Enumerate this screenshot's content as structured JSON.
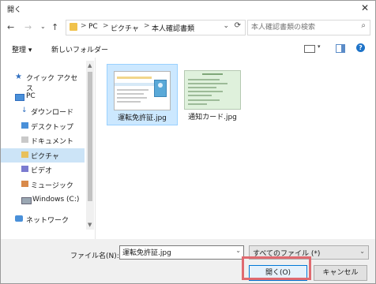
{
  "window": {
    "title": "開く",
    "close_glyph": "✕"
  },
  "nav": {
    "back_glyph": "←",
    "forward_glyph": "→",
    "history_glyph": "⌄",
    "up_glyph": "↑",
    "breadcrumb": [
      "PC",
      "ピクチャ",
      "本人確認書類"
    ],
    "crumb_separator": ">",
    "dropdown_glyph": "⌄",
    "refresh_glyph": "⟳",
    "search_placeholder": "本人確認書類の検索",
    "search_glyph": "⌕"
  },
  "toolbar": {
    "organize": "整理 ▾",
    "new_folder": "新しいフォルダー",
    "view_dropdown_glyph": "▾",
    "help": "?"
  },
  "sidebar": {
    "items": [
      {
        "label": "クイック アクセス",
        "icon": "star-icon",
        "glyph": "★"
      },
      {
        "label": "PC",
        "icon": "computer-icon"
      },
      {
        "label": "ダウンロード",
        "icon": "download-icon",
        "glyph": "↓"
      },
      {
        "label": "デスクトップ",
        "icon": "folder-icon"
      },
      {
        "label": "ドキュメント",
        "icon": "folder-icon"
      },
      {
        "label": "ピクチャ",
        "icon": "folder-icon"
      },
      {
        "label": "ビデオ",
        "icon": "folder-icon"
      },
      {
        "label": "ミュージック",
        "icon": "folder-icon"
      },
      {
        "label": "Windows (C:)",
        "icon": "drive-icon"
      },
      {
        "label": "ネットワーク",
        "icon": "network-icon"
      }
    ],
    "selected_item": "ピクチャ"
  },
  "files": [
    {
      "name": "運転免許証.jpg",
      "thumbnail": "drivers-license-thumbnail",
      "selected": true
    },
    {
      "name": "通知カード.jpg",
      "thumbnail": "notification-card-thumbnail",
      "selected": false
    }
  ],
  "bottom": {
    "filename_label": "ファイル名(N):",
    "filename_value": "運転免許証.jpg",
    "filetype_value": "すべてのファイル (*)",
    "dropdown_glyph": "⌄",
    "open_label": "開く(O)",
    "cancel_label": "キャンセル"
  },
  "colors": {
    "selection": "#cce8ff",
    "accent": "#0078d7",
    "highlight_border": "#e06a70"
  }
}
